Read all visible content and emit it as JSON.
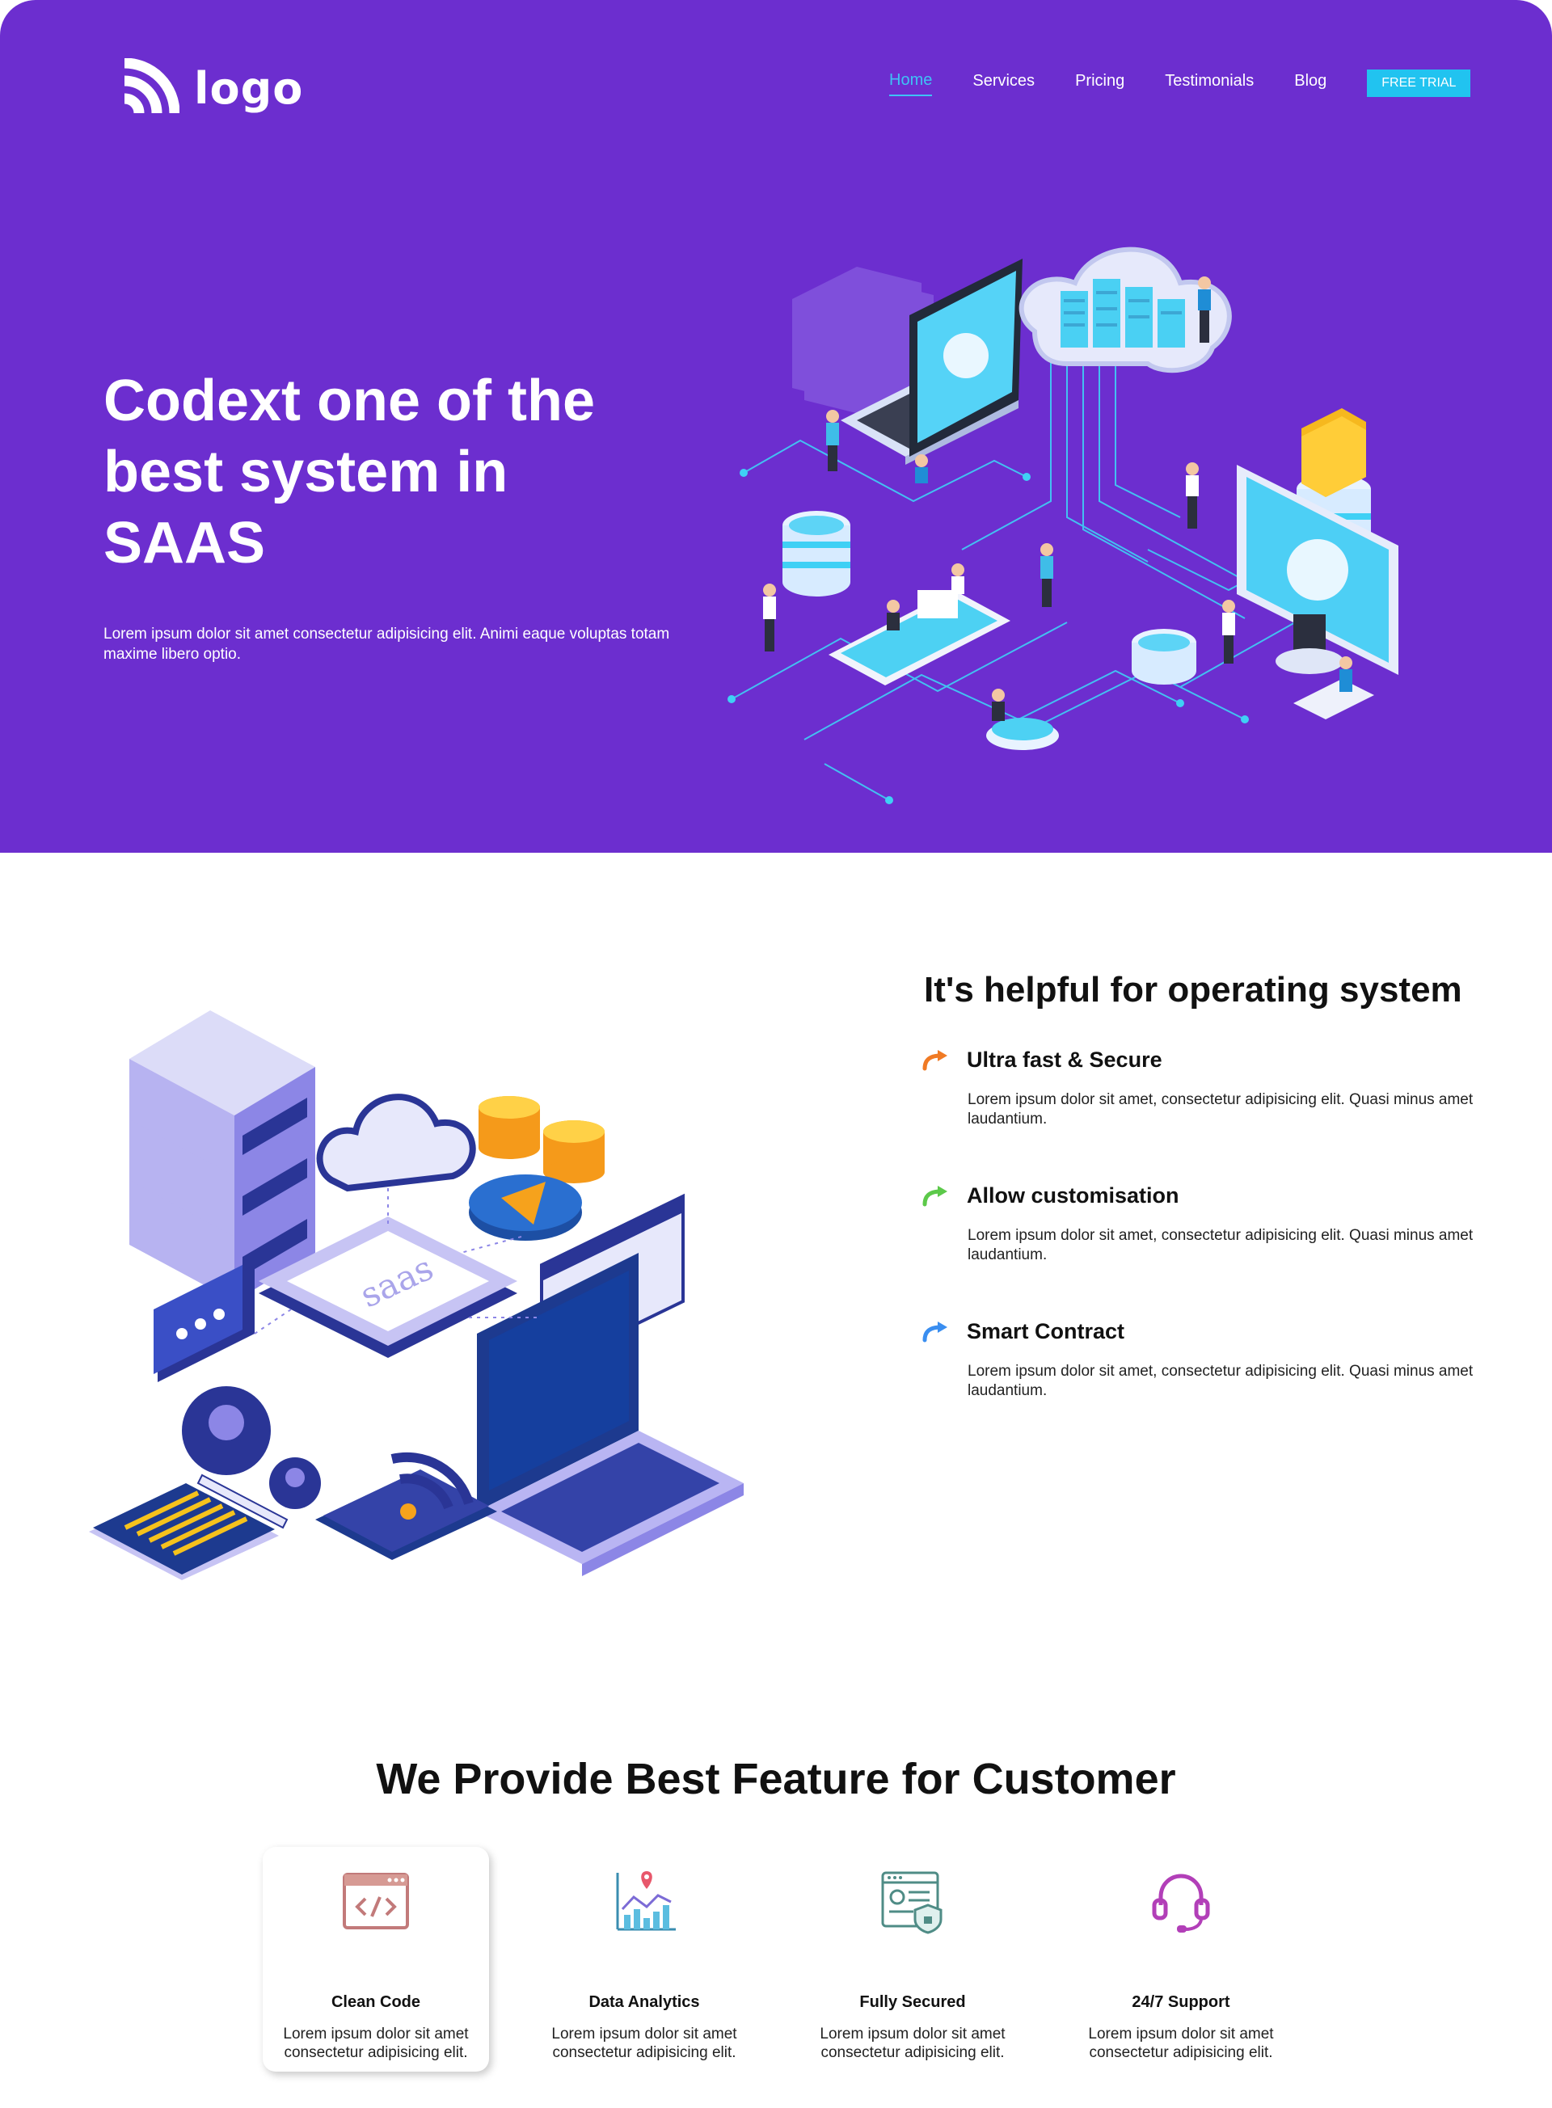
{
  "brand": {
    "logo_text": "logo"
  },
  "nav": {
    "items": [
      "Home",
      "Services",
      "Pricing",
      "Testimonials",
      "Blog"
    ],
    "active": "Home",
    "cta": "FREE TRIAL"
  },
  "hero": {
    "title": "Codext one of the best system in SAAS",
    "text": "Lorem ipsum dolor sit amet consectetur adipisicing elit. Animi eaque voluptas totam maxime libero optio."
  },
  "helpful": {
    "title": "It's helpful for operating system",
    "items": [
      {
        "title": "Ultra fast & Secure",
        "text": "Lorem ipsum dolor sit amet, consectetur adipisicing elit. Quasi minus amet laudantium.",
        "icon": "arrow-turn-icon",
        "color": "#f07a24"
      },
      {
        "title": "Allow customisation",
        "text": "Lorem ipsum dolor sit amet, consectetur adipisicing elit. Quasi minus amet laudantium.",
        "icon": "arrow-turn-icon",
        "color": "#5cc94a"
      },
      {
        "title": "Smart Contract",
        "text": "Lorem ipsum dolor sit amet, consectetur adipisicing elit. Quasi minus amet laudantium.",
        "icon": "arrow-turn-icon",
        "color": "#3a8ef0"
      }
    ]
  },
  "features": {
    "title": "We Provide Best Feature for Customer",
    "cards": [
      {
        "title": "Clean Code",
        "text": "Lorem ipsum dolor sit amet consectetur adipisicing elit.",
        "icon": "code-window-icon"
      },
      {
        "title": "Data Analytics",
        "text": "Lorem ipsum dolor sit amet consectetur adipisicing elit.",
        "icon": "analytics-chart-icon"
      },
      {
        "title": "Fully Secured",
        "text": "Lorem ipsum dolor sit amet consectetur adipisicing elit.",
        "icon": "secure-document-icon"
      },
      {
        "title": "24/7 Support",
        "text": "Lorem ipsum dolor sit amet consectetur adipisicing elit.",
        "icon": "headset-icon"
      }
    ]
  },
  "colors": {
    "hero_bg": "#6c2ecf",
    "accent": "#21c3f0",
    "nav_active": "#3ec3f5"
  }
}
